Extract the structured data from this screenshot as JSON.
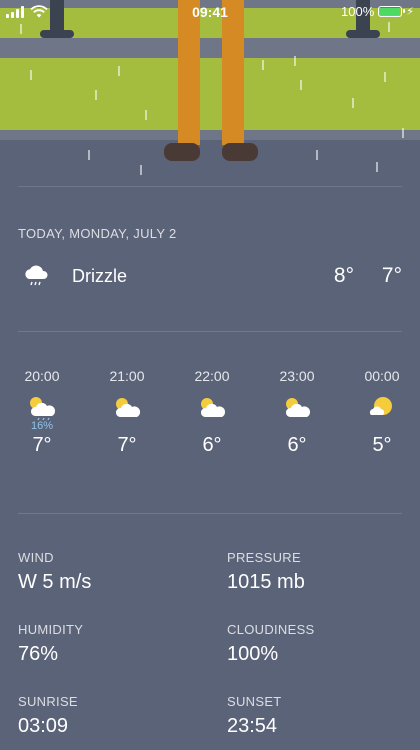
{
  "status_bar": {
    "time": "09:41",
    "battery_text": "100%",
    "battery_color": "#4cd964"
  },
  "colors": {
    "background": "#5b6378",
    "bench_green": "#a5bd3e",
    "legs": "#d58a24",
    "shoes": "#4a3a35",
    "precip": "#8fc3ea"
  },
  "today": {
    "label": "TODAY, MONDAY, JULY 2",
    "icon": "cloud-drizzle-icon",
    "condition": "Drizzle",
    "high": "8°",
    "low": "7°"
  },
  "hourly": [
    {
      "time": "20:00",
      "icon": "partly-sunny-rain-icon",
      "precip": "16%",
      "temp": "7°"
    },
    {
      "time": "21:00",
      "icon": "partly-sunny-icon",
      "precip": "",
      "temp": "7°"
    },
    {
      "time": "22:00",
      "icon": "partly-sunny-icon",
      "precip": "",
      "temp": "6°"
    },
    {
      "time": "23:00",
      "icon": "partly-sunny-icon",
      "precip": "",
      "temp": "6°"
    },
    {
      "time": "00:00",
      "icon": "sunny-cloud-icon",
      "precip": "",
      "temp": "5°"
    }
  ],
  "details": {
    "wind": {
      "label": "WIND",
      "value": "W 5 m/s"
    },
    "pressure": {
      "label": "PRESSURE",
      "value": "1015 mb"
    },
    "humidity": {
      "label": "HUMIDITY",
      "value": "76%"
    },
    "cloudiness": {
      "label": "CLOUDINESS",
      "value": "100%"
    },
    "sunrise": {
      "label": "SUNRISE",
      "value": "03:09"
    },
    "sunset": {
      "label": "SUNSET",
      "value": "23:54"
    }
  }
}
